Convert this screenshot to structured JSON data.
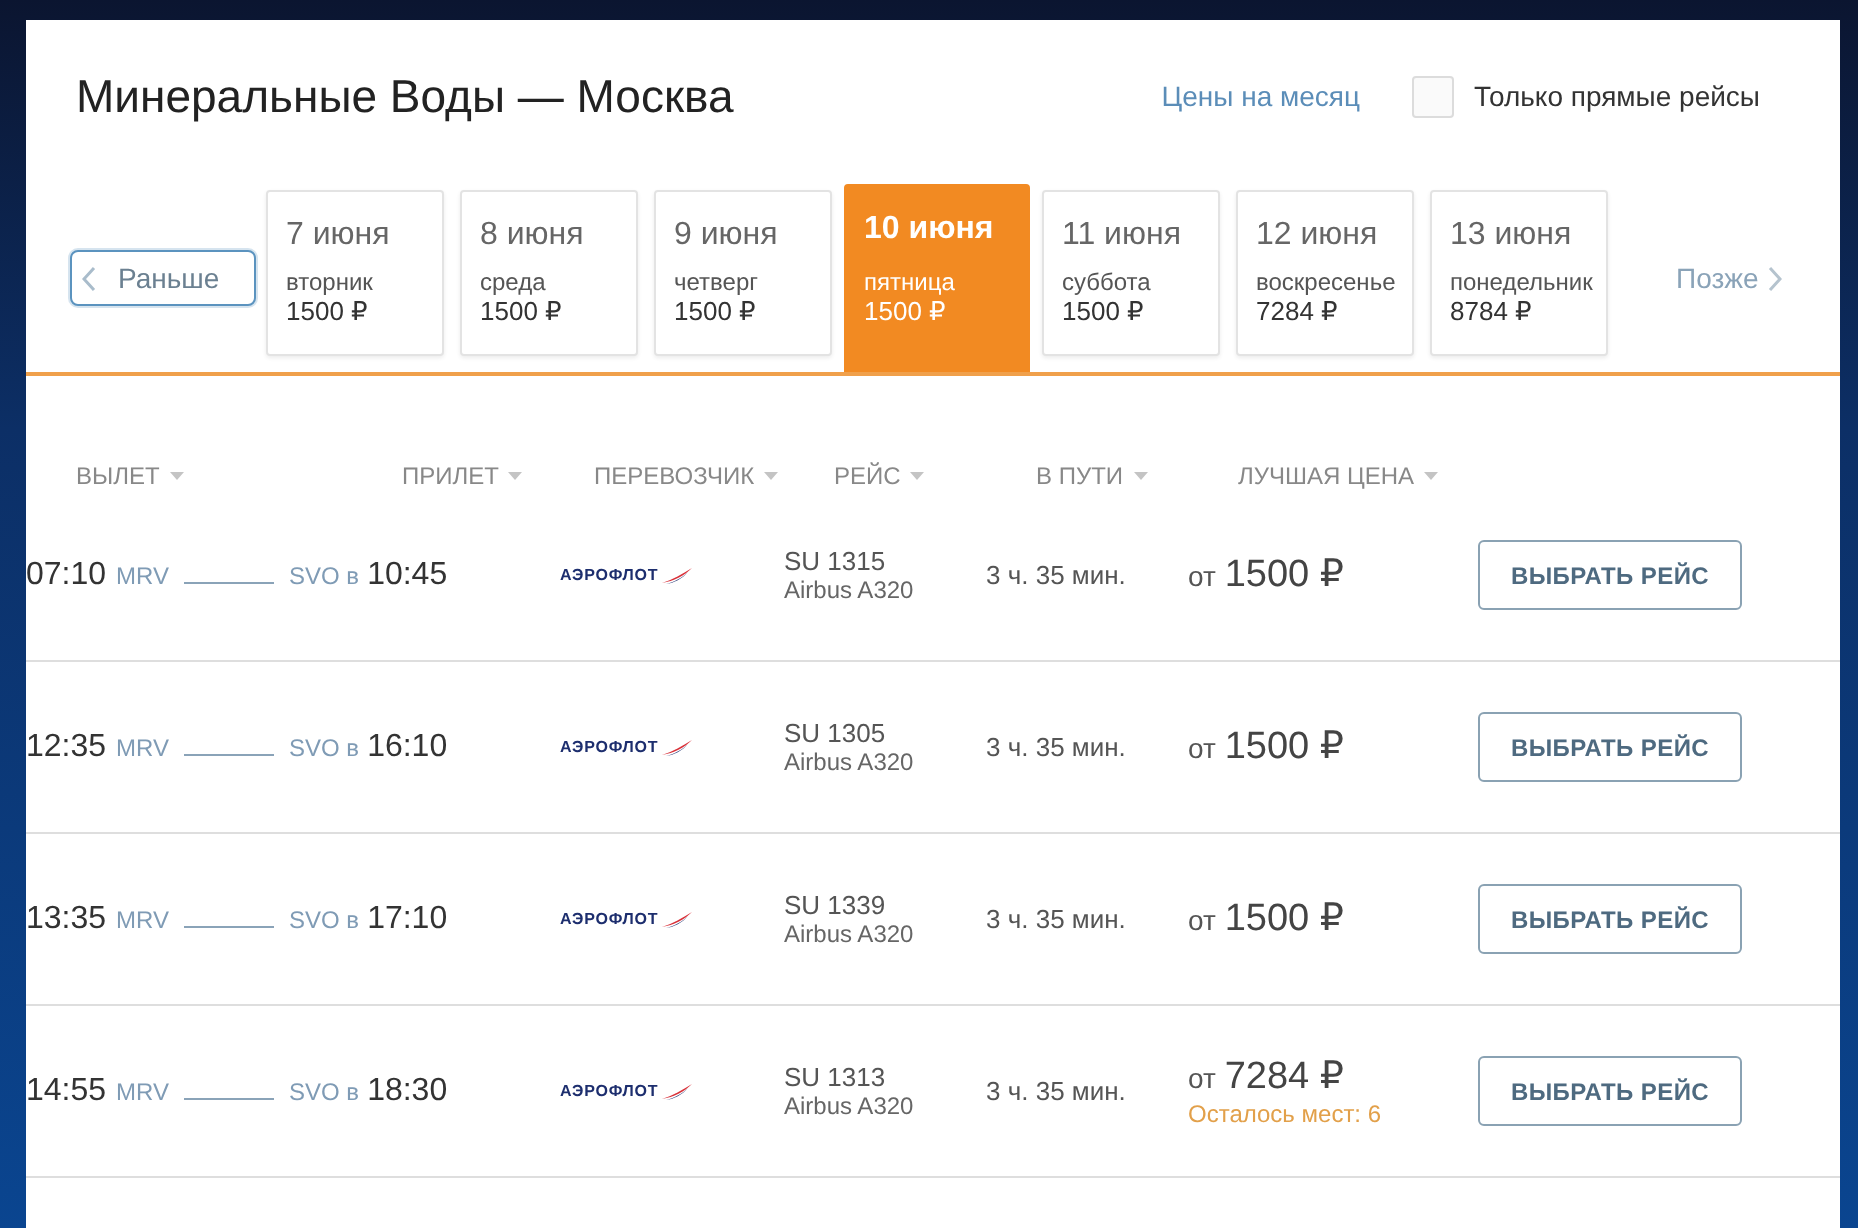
{
  "header": {
    "title": "Минеральные Воды — Москва",
    "month_prices_link": "Цены на месяц",
    "direct_only": {
      "label": "Только прямые рейсы",
      "checked": false
    }
  },
  "date_strip": {
    "earlier": "Раньше",
    "later": "Позже",
    "dates": [
      {
        "date": "7 июня",
        "weekday": "вторник",
        "price": "1500 ₽",
        "selected": false
      },
      {
        "date": "8 июня",
        "weekday": "среда",
        "price": "1500 ₽",
        "selected": false
      },
      {
        "date": "9 июня",
        "weekday": "четверг",
        "price": "1500 ₽",
        "selected": false
      },
      {
        "date": "10 июня",
        "weekday": "пятница",
        "price": "1500 ₽",
        "selected": true
      },
      {
        "date": "11 июня",
        "weekday": "суббота",
        "price": "1500 ₽",
        "selected": false
      },
      {
        "date": "12 июня",
        "weekday": "воскресенье",
        "price": "7284 ₽",
        "selected": false
      },
      {
        "date": "13 июня",
        "weekday": "понедельник",
        "price": "8784 ₽",
        "selected": false
      }
    ]
  },
  "table": {
    "columns": [
      "ВЫЛЕТ",
      "ПРИЛЕТ",
      "ПЕРЕВОЗЧИК",
      "РЕЙС",
      "В ПУТИ",
      "ЛУЧШАЯ ЦЕНА"
    ],
    "rows": [
      {
        "departure_time": "07:10",
        "origin": "MRV",
        "destination": "SVO в",
        "arrival_time": "10:45",
        "carrier": "АЭРОФЛОТ",
        "flight": "SU 1315",
        "aircraft": "Airbus A320",
        "duration": "3 ч. 35 мин.",
        "price_prefix": "от",
        "price": "1500 ₽",
        "button": "ВЫБРАТЬ РЕЙС"
      },
      {
        "departure_time": "12:35",
        "origin": "MRV",
        "destination": "SVO в",
        "arrival_time": "16:10",
        "carrier": "АЭРОФЛОТ",
        "flight": "SU 1305",
        "aircraft": "Airbus A320",
        "duration": "3 ч. 35 мин.",
        "price_prefix": "от",
        "price": "1500 ₽",
        "button": "ВЫБРАТЬ РЕЙС"
      },
      {
        "departure_time": "13:35",
        "origin": "MRV",
        "destination": "SVO в",
        "arrival_time": "17:10",
        "carrier": "АЭРОФЛОТ",
        "flight": "SU 1339",
        "aircraft": "Airbus A320",
        "duration": "3 ч. 35 мин.",
        "price_prefix": "от",
        "price": "1500 ₽",
        "button": "ВЫБРАТЬ РЕЙС"
      },
      {
        "departure_time": "14:55",
        "origin": "MRV",
        "destination": "SVO в",
        "arrival_time": "18:30",
        "carrier": "АЭРОФЛОТ",
        "flight": "SU 1313",
        "aircraft": "Airbus A320",
        "duration": "3 ч. 35 мин.",
        "price_prefix": "от",
        "price": "7284 ₽",
        "seats_left": "Осталось мест: 6",
        "button": "ВЫБРАТЬ РЕЙС"
      }
    ]
  }
}
